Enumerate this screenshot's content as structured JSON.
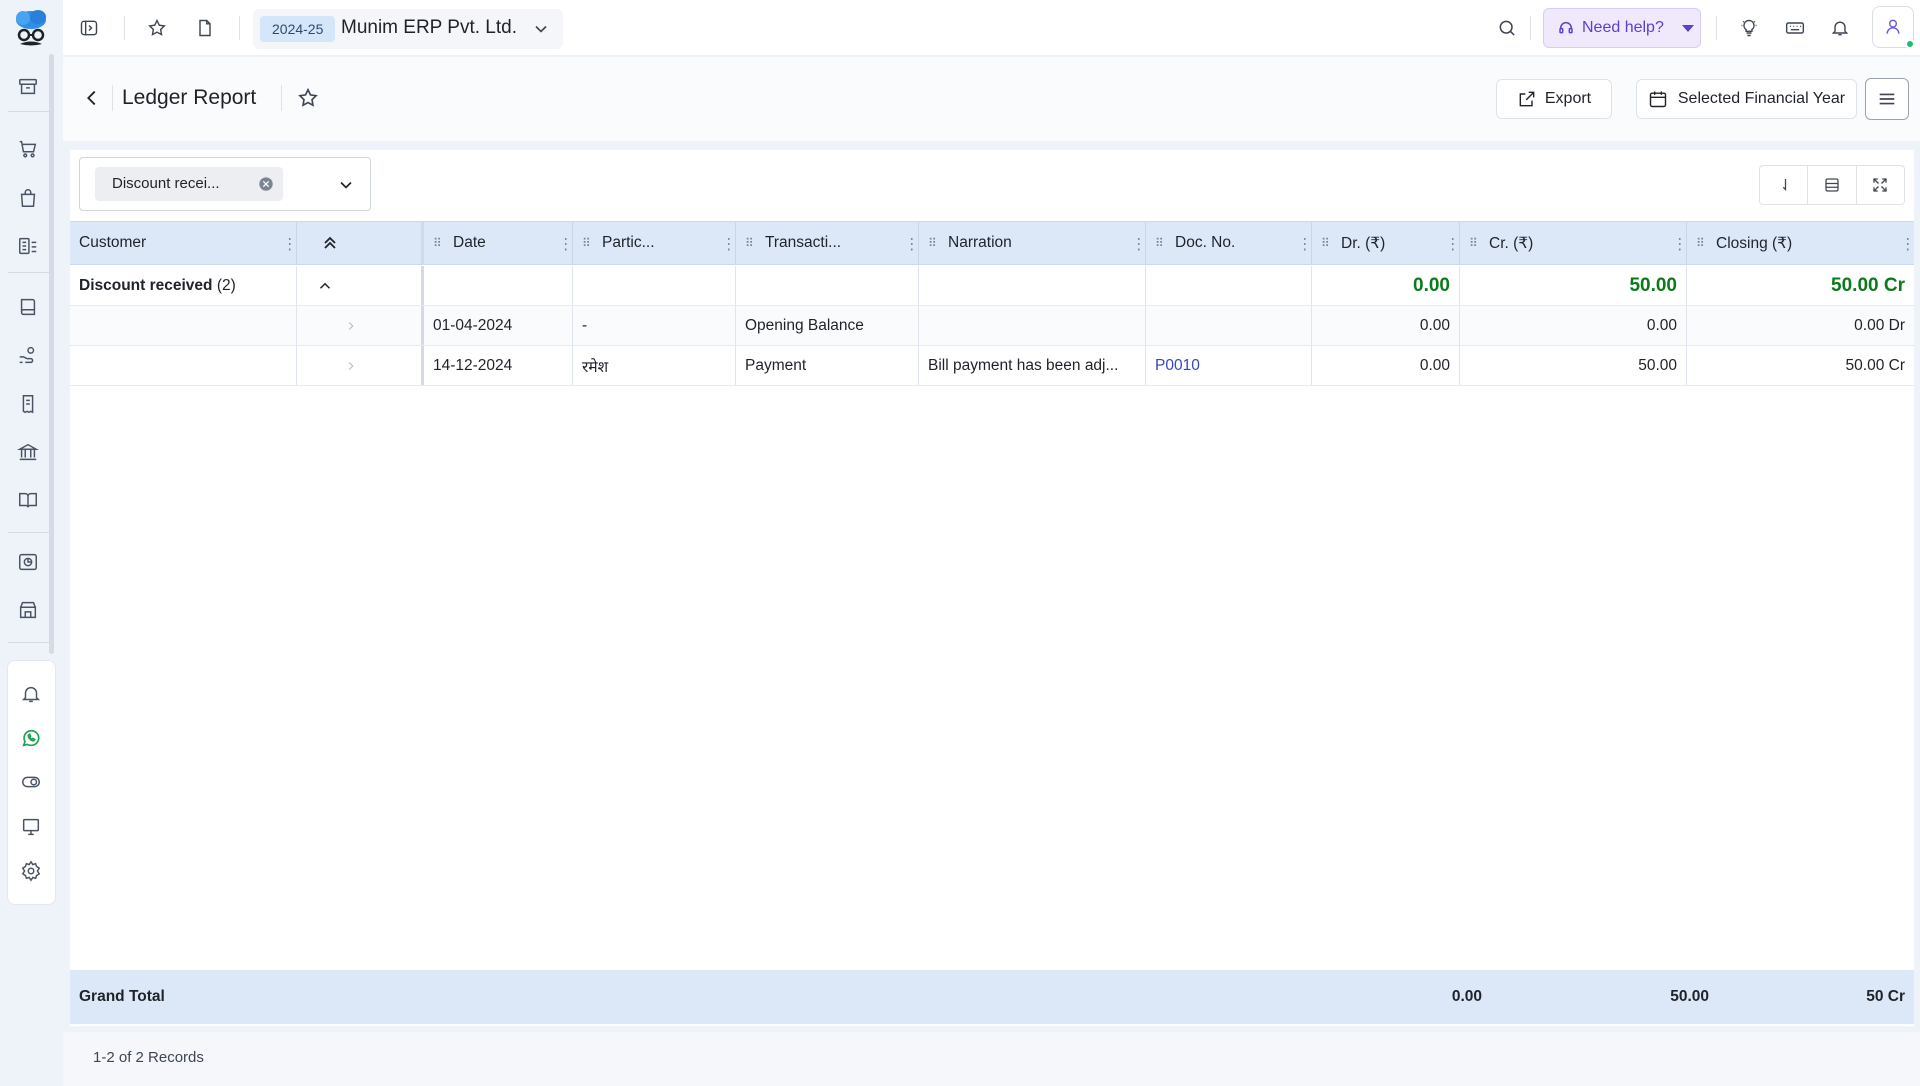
{
  "topbar": {
    "fy_badge": "2024-25",
    "company_name": "Munim ERP Pvt. Ltd.",
    "help_label": "Need help?"
  },
  "page": {
    "title": "Ledger Report",
    "export_label": "Export",
    "fy_button_label": "Selected Financial Year"
  },
  "filter": {
    "chip_label": "Discount recei..."
  },
  "grid": {
    "columns": {
      "customer": "Customer",
      "date": "Date",
      "particulars": "Partic...",
      "transaction": "Transacti...",
      "narration": "Narration",
      "doc_no": "Doc. No.",
      "dr": "Dr. (₹)",
      "cr": "Cr. (₹)",
      "closing": "Closing (₹)"
    },
    "group": {
      "name": "Discount received",
      "count": "(2)",
      "dr": "0.00",
      "cr": "50.00",
      "closing": "50.00 Cr"
    },
    "rows": [
      {
        "date": "01-04-2024",
        "particulars": "-",
        "transaction": "Opening Balance",
        "narration": "",
        "doc_no": "",
        "dr": "0.00",
        "cr": "0.00",
        "closing": "0.00 Dr"
      },
      {
        "date": "14-12-2024",
        "particulars": "रमेश",
        "transaction": "Payment",
        "narration": "Bill payment has been adj...",
        "doc_no": "P0010",
        "dr": "0.00",
        "cr": "50.00",
        "closing": "50.00 Cr"
      }
    ],
    "grand_total": {
      "label": "Grand Total",
      "dr": "0.00",
      "cr": "50.00",
      "closing": "50 Cr"
    }
  },
  "footer": {
    "records": "1-2 of 2 Records"
  },
  "colors": {
    "accent": "#5b3fd1",
    "green": "#0b7a1a",
    "link": "#3347c7",
    "header_bg": "#dce8f7"
  }
}
